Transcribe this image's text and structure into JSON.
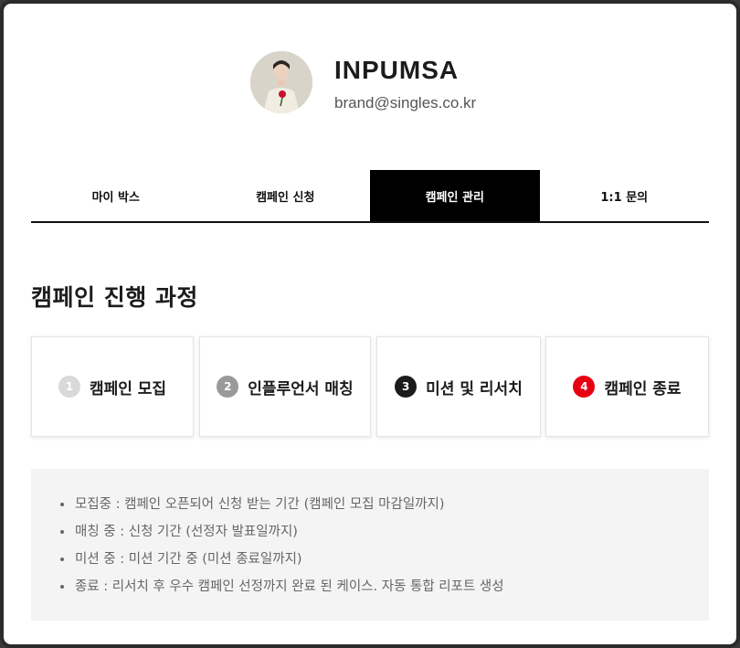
{
  "profile": {
    "name": "INPUMSA",
    "email": "brand@singles.co.kr",
    "avatar_icon": "person-photo-icon"
  },
  "tabs": [
    {
      "label": "마이 박스",
      "active": false
    },
    {
      "label": "캠페인 신청",
      "active": false
    },
    {
      "label": "캠페인 관리",
      "active": true
    },
    {
      "label": "1:1 문의",
      "active": false
    }
  ],
  "section_title": "캠페인 진행 과정",
  "steps": [
    {
      "number": "1",
      "label": "캠페인 모집",
      "color": "#d9d9d9"
    },
    {
      "number": "2",
      "label": "인플루언서 매칭",
      "color": "#9a9a9a"
    },
    {
      "number": "3",
      "label": "미션 및 리서치",
      "color": "#1c1c1c"
    },
    {
      "number": "4",
      "label": "캠페인 종료",
      "color": "#e60012"
    }
  ],
  "info_items": [
    "모집중 : 캠페인 오픈되어 신청 받는 기간 (캠페인 모집 마감일까지)",
    "매칭 중 : 신청 기간 (선정자 발표일까지)",
    "미션 중 : 미션 기간 중 (미션 종료일까지)",
    "종료 : 리서치 후 우수 캠페인 선정까지 완료 된 케이스. 자동 통합 리포트 생성"
  ]
}
